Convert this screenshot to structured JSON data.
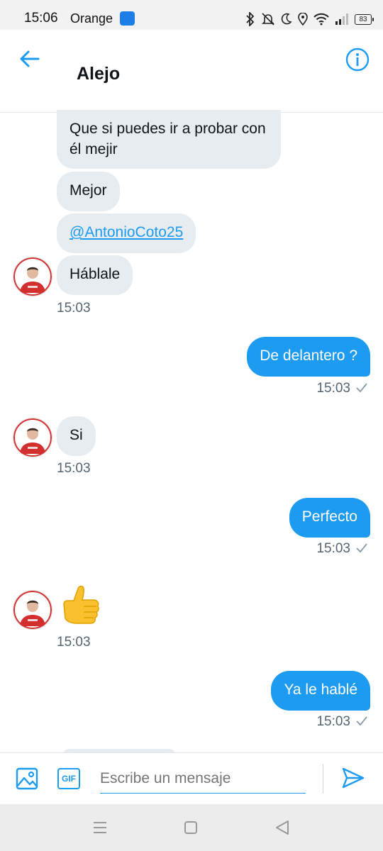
{
  "status_bar": {
    "time": "15:06",
    "carrier": "Orange",
    "battery": "83"
  },
  "header": {
    "title": "Alejo"
  },
  "messages": {
    "m1": "Que si puedes ir a probar con él mejir",
    "m2": "Mejor",
    "m3": "@AntonioCoto25",
    "m4": "Háblale",
    "m4_time": "15:03",
    "m5": "De delantero ?",
    "m5_time": "15:03",
    "m6": "Si",
    "m6_time": "15:03",
    "m7": "Perfecto",
    "m7_time": "15:03",
    "m8": "👍",
    "m8_time": "15:03",
    "m9": "Ya le hablé",
    "m9_time": "15:03"
  },
  "composer": {
    "placeholder": "Escribe un mensaje",
    "gif_label": "GIF"
  },
  "colors": {
    "accent": "#1d9bf0",
    "incoming_bubble": "#e7ecf0"
  },
  "icons": [
    "back-arrow-icon",
    "info-icon",
    "image-icon",
    "gif-icon",
    "send-icon",
    "read-check-icon"
  ]
}
